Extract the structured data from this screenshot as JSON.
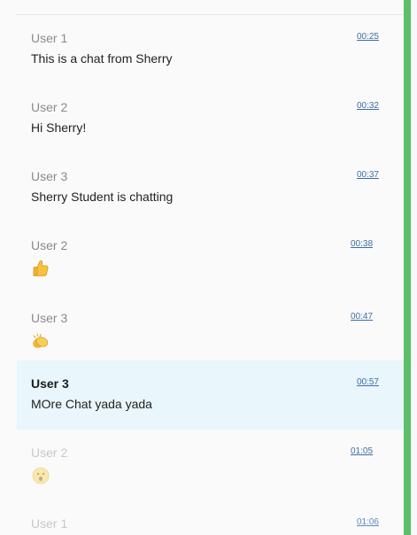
{
  "accent_color": "#5bbf69",
  "highlight_color": "#e9f6fb",
  "messages": [
    {
      "user": "User 1",
      "text": "This is a chat from Sherry",
      "time": "00:25"
    },
    {
      "user": "User 2",
      "text": "Hi Sherry!",
      "time": "00:32"
    },
    {
      "user": "User 3",
      "text": "Sherry Student is chatting",
      "time": "00:37"
    },
    {
      "user": "User 2",
      "emoji": "thumbs-up-icon",
      "time": "00:38"
    },
    {
      "user": "User 3",
      "emoji": "clapping-hands-icon",
      "time": "00:47"
    },
    {
      "user": "User 3",
      "text": "MOre Chat  yada yada",
      "time": "00:57",
      "highlighted": true
    },
    {
      "user": "User 2",
      "emoji": "surprised-face-icon",
      "time": "01:05"
    },
    {
      "user": "User 1",
      "text": "",
      "time": "01:06"
    }
  ]
}
